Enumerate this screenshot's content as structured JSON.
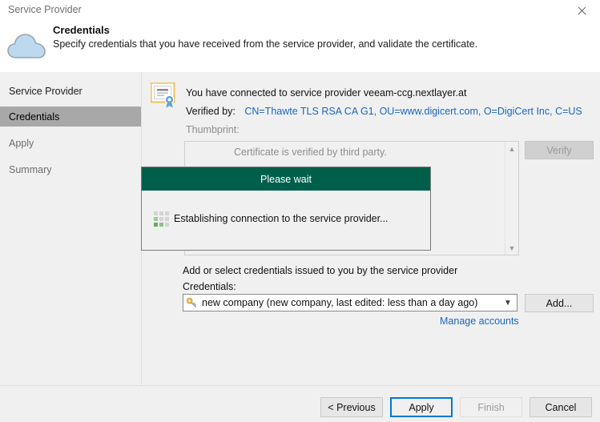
{
  "window": {
    "title": "Service Provider",
    "close_icon": "close-icon"
  },
  "header": {
    "icon": "cloud-icon",
    "title": "Credentials",
    "subtitle": "Specify credentials that you have received from the service provider, and validate the certificate."
  },
  "sidebar": {
    "items": [
      {
        "label": "Service Provider",
        "state": "normal"
      },
      {
        "label": "Credentials",
        "state": "active"
      },
      {
        "label": "Apply",
        "state": "disabled"
      },
      {
        "label": "Summary",
        "state": "disabled"
      }
    ]
  },
  "certificate": {
    "icon": "certificate-icon",
    "connected_text": "You have connected to service provider veeam-ccg.nextlayer.at",
    "verified_by_label": "Verified by:",
    "verified_by_value": "CN=Thawte TLS RSA CA G1, OU=www.digicert.com, O=DigiCert Inc, C=US",
    "thumbprint_label": "Thumbprint:",
    "thumbprint_text": "Certificate is verified by third party.",
    "verify_button": "Verify",
    "scroll_up_icon": "chevron-up-icon",
    "scroll_down_icon": "chevron-down-icon"
  },
  "credentials": {
    "hint": "Add or select credentials issued to you by the service provider",
    "label": "Credentials:",
    "selected": "new company (new company, last edited: less than a day ago)",
    "key_icon": "key-icon",
    "dropdown_icon": "chevron-down-icon",
    "add_button": "Add...",
    "manage_link": "Manage accounts"
  },
  "wait_dialog": {
    "title": "Please wait",
    "message": "Establishing connection to the service provider...",
    "spinner_icon": "dots-progress-icon",
    "header_color": "#005f4b"
  },
  "footer": {
    "previous": "< Previous",
    "apply": "Apply",
    "finish": "Finish",
    "cancel": "Cancel"
  },
  "colors": {
    "accent_green": "#005f4b",
    "link_blue": "#1867c0",
    "focus_blue": "#0078d7",
    "nav_active_bg": "#a8a8a8",
    "window_bg": "#f0f0f0"
  }
}
